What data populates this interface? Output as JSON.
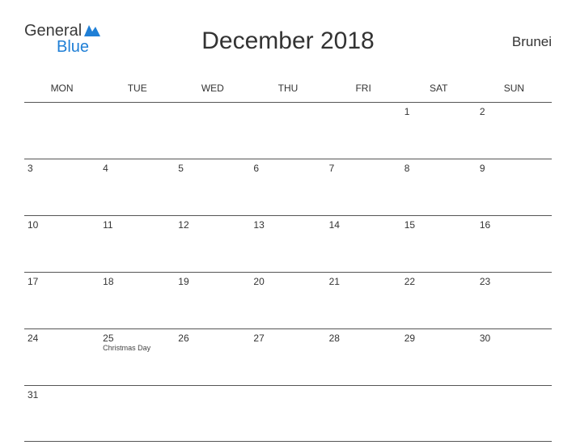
{
  "logo": {
    "line1": "General",
    "line2": "Blue"
  },
  "title": "December 2018",
  "region": "Brunei",
  "weekdays": [
    "MON",
    "TUE",
    "WED",
    "THU",
    "FRI",
    "SAT",
    "SUN"
  ],
  "weeks": [
    [
      {
        "n": ""
      },
      {
        "n": ""
      },
      {
        "n": ""
      },
      {
        "n": ""
      },
      {
        "n": ""
      },
      {
        "n": "1"
      },
      {
        "n": "2"
      }
    ],
    [
      {
        "n": "3"
      },
      {
        "n": "4"
      },
      {
        "n": "5"
      },
      {
        "n": "6"
      },
      {
        "n": "7"
      },
      {
        "n": "8"
      },
      {
        "n": "9"
      }
    ],
    [
      {
        "n": "10"
      },
      {
        "n": "11"
      },
      {
        "n": "12"
      },
      {
        "n": "13"
      },
      {
        "n": "14"
      },
      {
        "n": "15"
      },
      {
        "n": "16"
      }
    ],
    [
      {
        "n": "17"
      },
      {
        "n": "18"
      },
      {
        "n": "19"
      },
      {
        "n": "20"
      },
      {
        "n": "21"
      },
      {
        "n": "22"
      },
      {
        "n": "23"
      }
    ],
    [
      {
        "n": "24"
      },
      {
        "n": "25",
        "e": "Christmas Day"
      },
      {
        "n": "26"
      },
      {
        "n": "27"
      },
      {
        "n": "28"
      },
      {
        "n": "29"
      },
      {
        "n": "30"
      }
    ],
    [
      {
        "n": "31"
      },
      {
        "n": ""
      },
      {
        "n": ""
      },
      {
        "n": ""
      },
      {
        "n": ""
      },
      {
        "n": ""
      },
      {
        "n": ""
      }
    ]
  ]
}
